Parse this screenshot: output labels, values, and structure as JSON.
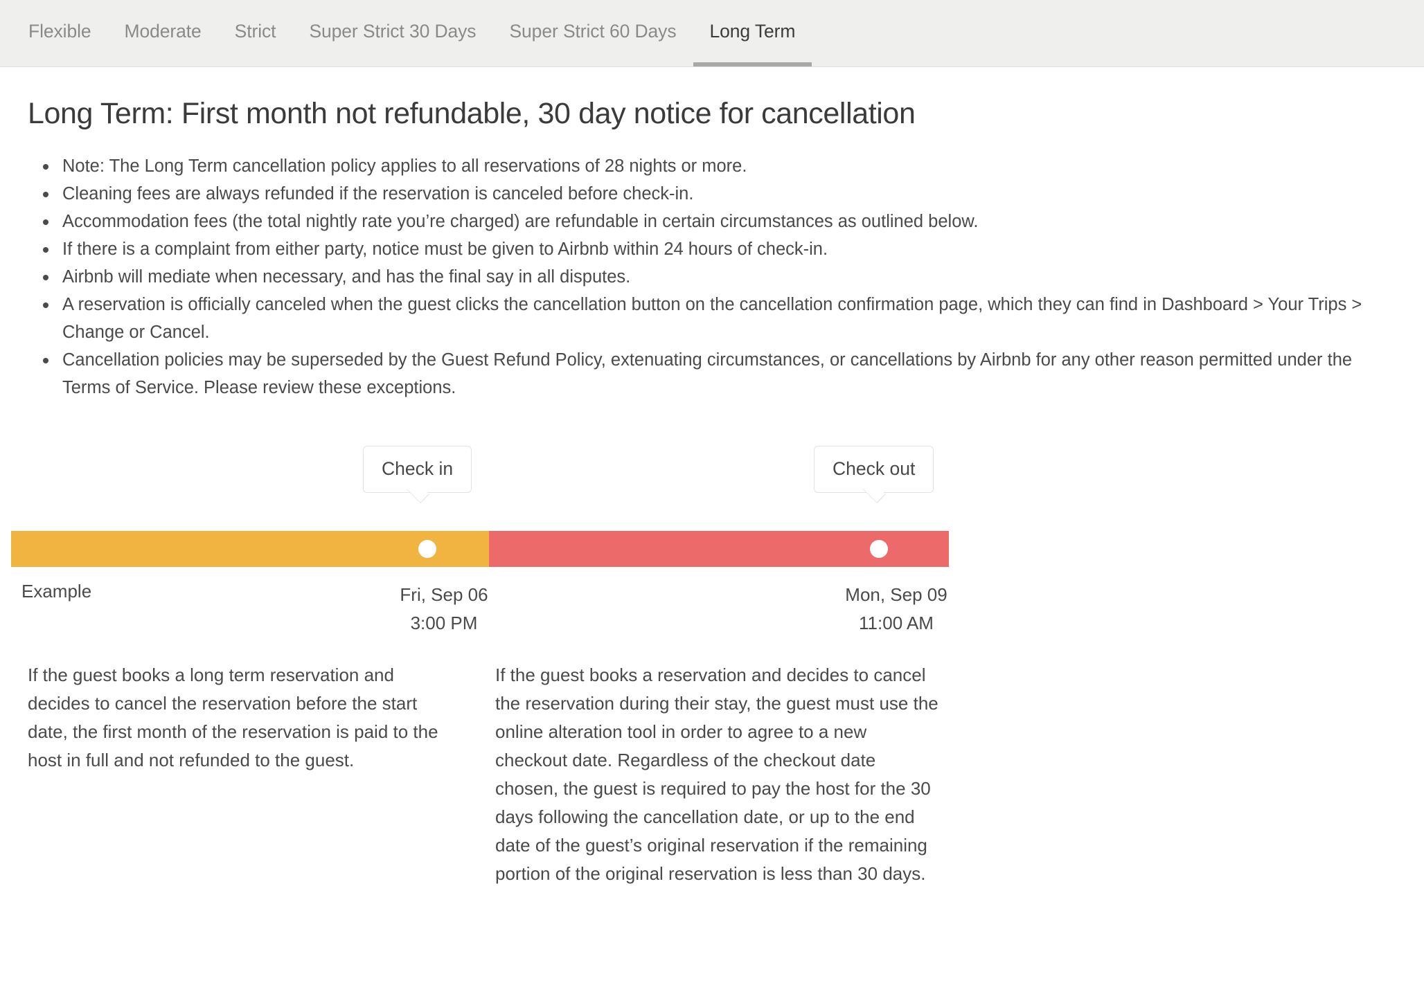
{
  "tabs": [
    {
      "label": "Flexible",
      "active": false
    },
    {
      "label": "Moderate",
      "active": false
    },
    {
      "label": "Strict",
      "active": false
    },
    {
      "label": "Super Strict 30 Days",
      "active": false
    },
    {
      "label": "Super Strict 60 Days",
      "active": false
    },
    {
      "label": "Long Term",
      "active": true
    }
  ],
  "heading": "Long Term: First month not refundable, 30 day notice for cancellation",
  "policy_points": [
    "Note: The Long Term cancellation policy applies to all reservations of 28 nights or more.",
    "Cleaning fees are always refunded if the reservation is canceled before check-in.",
    "Accommodation fees (the total nightly rate you’re charged) are refundable in certain circumstances as outlined below.",
    "If there is a complaint from either party, notice must be given to Airbnb within 24 hours of check-in.",
    "Airbnb will mediate when necessary, and has the final say in all disputes.",
    "A reservation is officially canceled when the guest clicks the cancellation button on the cancellation confirmation page, which they can find in Dashboard > Your Trips > Change or Cancel.",
    "Cancellation policies may be superseded by the Guest Refund Policy, extenuating circumstances, or cancellations by Airbnb for any other reason permitted under the Terms of Service. Please review these exceptions."
  ],
  "timeline": {
    "checkin_tooltip": "Check in",
    "checkout_tooltip": "Check out",
    "example_label": "Example",
    "checkin_date": "Fri, Sep 06",
    "checkin_time": "3:00 PM",
    "checkout_date": "Mon, Sep 09",
    "checkout_time": "11:00 AM",
    "stay_color": "#F2B441",
    "post_color": "#EC6A6A",
    "dot_color": "#FFFFFF"
  },
  "descriptions": {
    "left": "If the guest books a long term reservation and decides to cancel the reservation before the start date, the first month of the reservation is paid to the host in full and not refunded to the guest.",
    "right": "If the guest books a reservation and decides to cancel the reservation during their stay, the guest must use the online alteration tool in order to agree to a new checkout date. Regardless of the checkout date chosen, the guest is required to pay the host for the 30 days following the cancellation date, or up to the end date of the guest’s original reservation if the remaining portion of the original reservation is less than 30 days."
  },
  "colors": {
    "tabbar_bg": "#EFEFED",
    "active_tab_text": "#3C3C3C",
    "inactive_tab_text": "#8A8A8A",
    "active_tab_underline": "#A8A8A8",
    "body_text": "#4A4A4A",
    "heading_text": "#3B3B3B"
  }
}
